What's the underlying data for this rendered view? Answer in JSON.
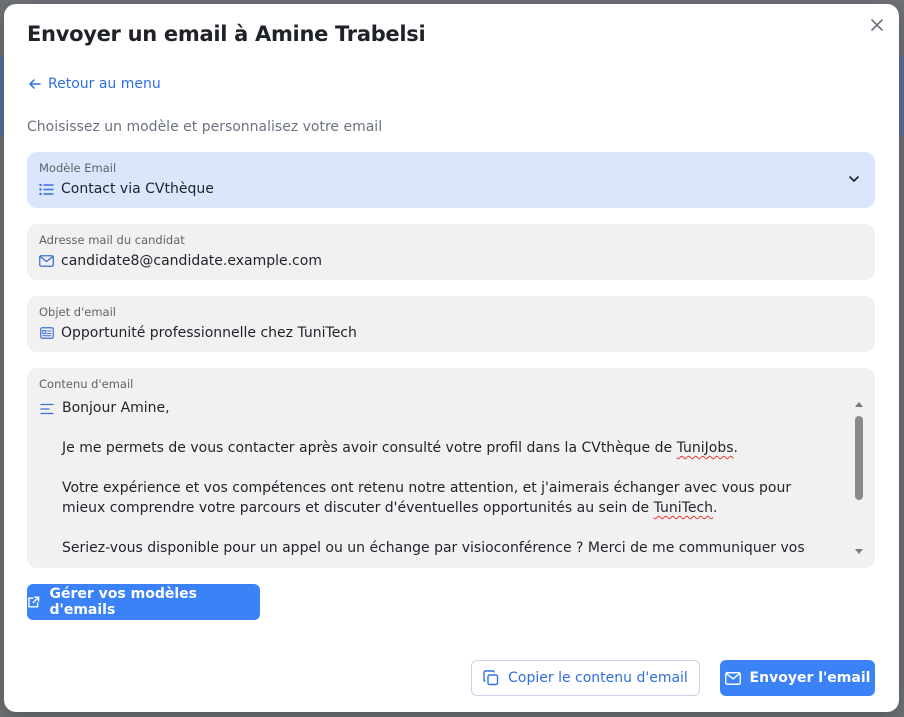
{
  "modal": {
    "title": "Envoyer un email à Amine Trabelsi",
    "back_label": "Retour au menu",
    "subtitle": "Choisissez un modèle et personnalisez votre email"
  },
  "template_select": {
    "label": "Modèle Email",
    "value": "Contact via CVthèque",
    "icon": "list-icon"
  },
  "email_field": {
    "label": "Adresse mail du candidat",
    "value": "candidate8@candidate.example.com",
    "icon": "mail-icon"
  },
  "subject_field": {
    "label": "Objet d'email",
    "value": "Opportunité professionnelle chez TuniTech",
    "icon": "id-card-icon"
  },
  "content_field": {
    "label": "Contenu d'email",
    "icon": "align-left-icon",
    "greeting": "Bonjour Amine,",
    "p1_before": "Je me permets de vous contacter après avoir consulté votre profil dans la CVthèque de ",
    "p1_word": "TuniJobs",
    "p1_after": ".",
    "p2_before": "Votre expérience et vos compétences ont retenu notre attention, et j'aimerais échanger avec vous pour mieux comprendre votre parcours et discuter d'éventuelles opportunités au sein de ",
    "p2_word": "TuniTech",
    "p2_after": ".",
    "p3": "Seriez-vous disponible pour un appel ou un échange par visioconférence ? Merci de me communiquer vos"
  },
  "buttons": {
    "manage": "Gérer vos modèles d'emails",
    "copy": "Copier le contenu d'email",
    "send": "Envoyer l'email"
  },
  "colors": {
    "accent": "#3b82f6",
    "link": "#2f6fe0",
    "select_bg": "#d9e6fb",
    "field_bg": "#f1f1f2"
  }
}
